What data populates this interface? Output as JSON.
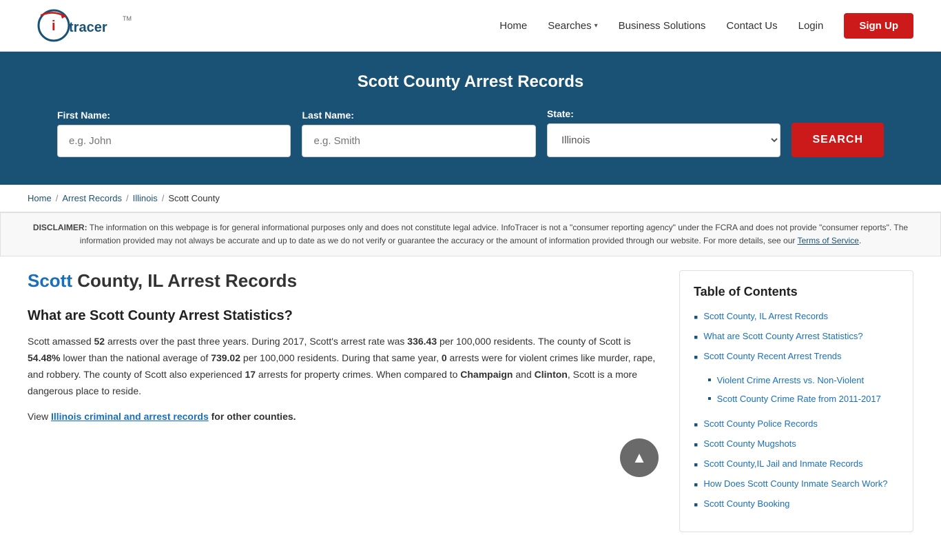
{
  "header": {
    "logo_alt": "InfoTracer",
    "nav": {
      "home": "Home",
      "searches": "Searches",
      "business_solutions": "Business Solutions",
      "contact_us": "Contact Us",
      "login": "Login",
      "signup": "Sign Up"
    }
  },
  "search_banner": {
    "title": "Scott County Arrest Records",
    "first_name_label": "First Name:",
    "first_name_placeholder": "e.g. John",
    "last_name_label": "Last Name:",
    "last_name_placeholder": "e.g. Smith",
    "state_label": "State:",
    "state_value": "Illinois",
    "search_button": "SEARCH"
  },
  "breadcrumb": {
    "home": "Home",
    "arrest_records": "Arrest Records",
    "illinois": "Illinois",
    "current": "Scott County"
  },
  "disclaimer": {
    "bold_text": "DISCLAIMER:",
    "text": " The information on this webpage is for general informational purposes only and does not constitute legal advice. InfoTracer is not a \"consumer reporting agency\" under the FCRA and does not provide \"consumer reports\". The information provided may not always be accurate and up to date as we do not verify or guarantee the accuracy or the amount of information provided through our website. For more details, see our ",
    "link_text": "Terms of Service",
    "end": "."
  },
  "article": {
    "title_highlight": "Scott",
    "title_rest": " County, IL Arrest Records",
    "section_title": "What are Scott County Arrest Statistics?",
    "body": "Scott amassed ",
    "arrests_number": "52",
    "body2": " arrests over the past three years. During 2017, Scott's arrest rate was ",
    "rate": "336.43",
    "body3": " per 100,000 residents. The county of Scott is ",
    "percent": "54.48%",
    "body4": " lower than the national average of ",
    "national": "739.02",
    "body5": " per 100,000 residents. During that same year, ",
    "violent": "0",
    "body6": " arrests were for violent crimes like murder, rape, and robbery. The county of Scott also experienced ",
    "property": "17",
    "body7": " arrests for property crimes. When compared to ",
    "city1": "Champaign",
    "body8": " and ",
    "city2": "Clinton",
    "body9": ", Scott is a more dangerous place to reside.",
    "cta_text": "View ",
    "cta_link": "Illinois criminal and arrest records",
    "cta_end": " for other counties."
  },
  "toc": {
    "title": "Table of Contents",
    "items": [
      {
        "text": "Scott County, IL Arrest Records",
        "href": "#"
      },
      {
        "text": "What are Scott County Arrest Statistics?",
        "href": "#"
      },
      {
        "text": "Scott County Recent Arrest Trends",
        "href": "#",
        "sub": [
          {
            "text": "Violent Crime Arrests vs. Non-Violent",
            "href": "#"
          },
          {
            "text": "Scott County Crime Rate from 2011-2017",
            "href": "#"
          }
        ]
      },
      {
        "text": "Scott County Police Records",
        "href": "#"
      },
      {
        "text": "Scott County Mugshots",
        "href": "#"
      },
      {
        "text": "Scott County,IL Jail and Inmate Records",
        "href": "#"
      },
      {
        "text": "How Does Scott County Inmate Search Work?",
        "href": "#"
      },
      {
        "text": "Scott County Booking",
        "href": "#"
      }
    ]
  }
}
